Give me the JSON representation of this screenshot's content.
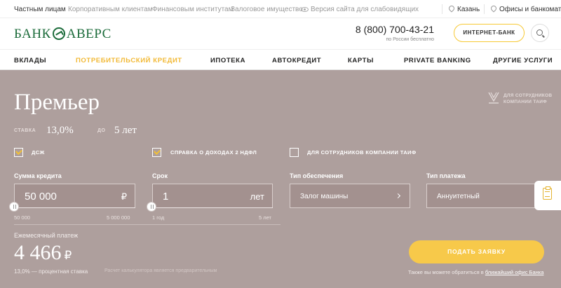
{
  "topbar": {
    "segments": [
      "Частным лицам",
      "Корпоративным клиентам",
      "Финансовым институтам",
      "Залоговое имущество"
    ],
    "accessibility_link": "Версия сайта для слабовидящих",
    "city": "Казань",
    "offices": "Офисы и банкоматы"
  },
  "header": {
    "logo_left": "БАНК",
    "logo_right": "АВЕРС",
    "phone": "8 (800) 700-43-21",
    "phone_note": "по России бесплатно",
    "internet_bank": "ИНТЕРНЕТ-БАНК"
  },
  "nav": {
    "items": [
      "ВКЛАДЫ",
      "ПОТРЕБИТЕЛЬСКИЙ КРЕДИТ",
      "ИПОТЕКА",
      "АВТОКРЕДИТ",
      "КАРТЫ",
      "PRIVATE BANKING",
      "ДРУГИЕ УСЛУГИ"
    ],
    "active_index": 1
  },
  "calculator": {
    "title": "Премьер",
    "taif_badge": [
      "ДЛЯ СОТРУДНИКОВ",
      "КОМПАНИИ ТАИФ"
    ],
    "rate_label": "СТАВКА",
    "rate_value": "13,0%",
    "term_label": "ДО",
    "term_value": "5 лет",
    "checkboxes": [
      {
        "label": "ДСЖ",
        "checked": true
      },
      {
        "label": "СПРАВКА О ДОХОДАХ 2 НДФЛ",
        "checked": true
      },
      {
        "label": "ДЛЯ СОТРУДНИКОВ КОМПАНИИ ТАИФ",
        "checked": false
      }
    ],
    "amount": {
      "label": "Сумма кредита",
      "value": "50 000",
      "unit": "₽",
      "min": "50 000",
      "max": "5 000 000"
    },
    "term": {
      "label": "Срок",
      "value": "1",
      "unit": "лет",
      "min": "1 год",
      "max": "5 лет"
    },
    "collateral": {
      "label": "Тип обеспечения",
      "value": "Залог машины"
    },
    "payment_type": {
      "label": "Тип платежа",
      "value": "Аннуитетный"
    },
    "monthly_label": "Ежемесячный платеж",
    "monthly_value": "4 466",
    "currency": "₽",
    "rate_footnote": "13,0% — процентная ставка",
    "disclaimer": "Расчет калькулятора является предварительным",
    "apply_button": "ПОДАТЬ ЗАЯВКУ",
    "office_note_prefix": "Также вы можете обратиться в",
    "office_note_link": "ближайший офис Банка"
  },
  "colors": {
    "panel_bg": "#ae9f9d",
    "accent_yellow": "#f7c94a",
    "brand_green": "#1b6b3a"
  }
}
